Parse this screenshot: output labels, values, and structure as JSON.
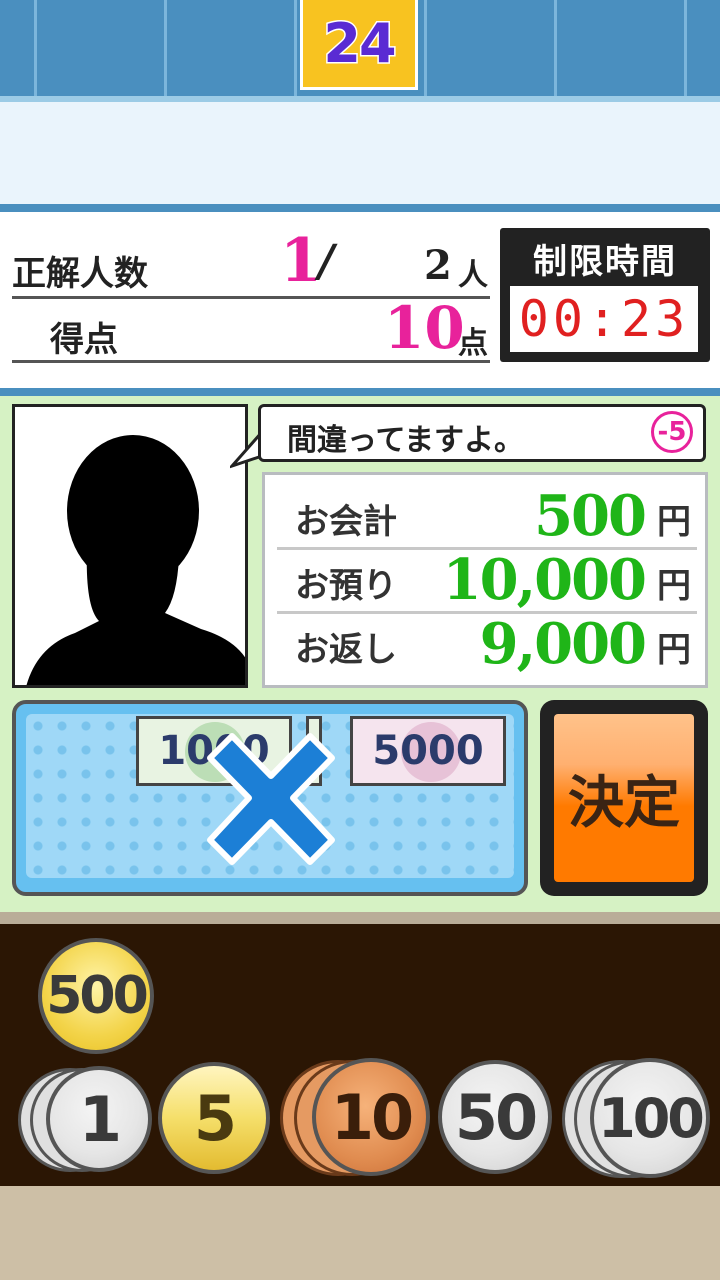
{
  "header": {
    "round_number": "24"
  },
  "score": {
    "correct_label": "正解人数",
    "correct_count": "1",
    "correct_sep": "/",
    "total_count": "2",
    "people_unit": "人",
    "points_label": "得点",
    "points_value": "10",
    "points_unit": "点"
  },
  "timer": {
    "label": "制限時間",
    "value": "00:23"
  },
  "customer": {
    "speech": "間違ってますよ。",
    "penalty": "-5"
  },
  "receipt": {
    "rows": [
      {
        "label": "お会計",
        "value": "500",
        "unit": "円"
      },
      {
        "label": "お預り",
        "value": "10,000",
        "unit": "円"
      },
      {
        "label": "お返し",
        "value": "9,000",
        "unit": "円"
      }
    ]
  },
  "tray": {
    "bills": [
      "1000",
      "5000"
    ]
  },
  "decide_button": {
    "label": "決定"
  },
  "coins": {
    "selected": "500",
    "row": [
      "1",
      "5",
      "10",
      "50",
      "100"
    ]
  },
  "colors": {
    "accent_blue": "#4a8fbf",
    "pink": "#e8229b",
    "green_amount": "#1fb518",
    "timer_red": "#e02020",
    "decide_orange": "#ff7a00"
  }
}
